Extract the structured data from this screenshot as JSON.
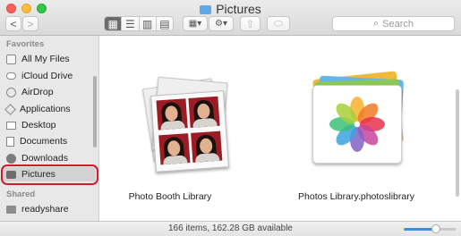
{
  "window": {
    "title": "Pictures"
  },
  "toolbar": {
    "back_label": "<",
    "forward_label": ">",
    "view_glyphs": [
      "▦",
      "☰",
      "▥",
      "▤"
    ],
    "arrange_glyph": "▦▾",
    "action_glyph": "⚙▾",
    "share_glyph": "⇧",
    "tags_glyph": "⬭"
  },
  "search": {
    "placeholder": "Search",
    "icon": "search-icon"
  },
  "sidebar": {
    "favorites_title": "Favorites",
    "favorites": [
      {
        "label": "All My Files",
        "icon": "all-files-icon"
      },
      {
        "label": "iCloud Drive",
        "icon": "cloud-icon"
      },
      {
        "label": "AirDrop",
        "icon": "airdrop-icon"
      },
      {
        "label": "Applications",
        "icon": "applications-icon"
      },
      {
        "label": "Desktop",
        "icon": "desktop-icon"
      },
      {
        "label": "Documents",
        "icon": "documents-icon"
      },
      {
        "label": "Downloads",
        "icon": "downloads-icon"
      },
      {
        "label": "Pictures",
        "icon": "pictures-icon",
        "selected": true
      }
    ],
    "shared_title": "Shared",
    "shared": [
      {
        "label": "readyshare",
        "icon": "network-drive-icon"
      }
    ]
  },
  "items": [
    {
      "label": "Photo Booth Library",
      "icon": "photo-booth-library-icon"
    },
    {
      "label": "Photos Library.photoslibrary",
      "icon": "photos-library-icon"
    }
  ],
  "status": {
    "text": "166 items, 162.28 GB available"
  },
  "colors": {
    "highlight": "#cc1f2b",
    "selection": "#d2d2d3",
    "accent": "#3a8ee8"
  }
}
